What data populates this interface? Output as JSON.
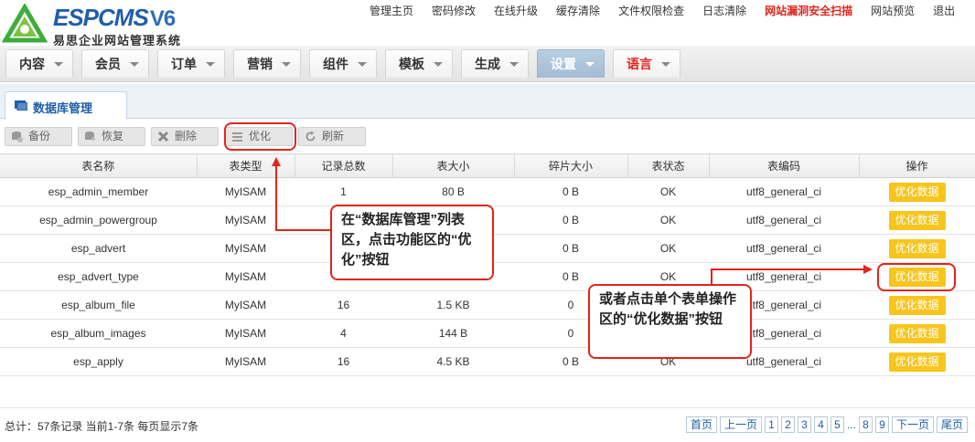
{
  "brand": {
    "logo_text": "ESPCMS",
    "logo_version": "V6",
    "logo_subtitle": "易思企业网站管理系统"
  },
  "top_links": [
    {
      "label": "管理主页",
      "warn": false
    },
    {
      "label": "密码修改",
      "warn": false
    },
    {
      "label": "在线升级",
      "warn": false
    },
    {
      "label": "缓存清除",
      "warn": false
    },
    {
      "label": "文件权限检查",
      "warn": false
    },
    {
      "label": "日志清除",
      "warn": false
    },
    {
      "label": "网站漏洞安全扫描",
      "warn": true
    },
    {
      "label": "网站预览",
      "warn": false
    },
    {
      "label": "退出",
      "warn": false
    }
  ],
  "main_nav": [
    {
      "label": "内容",
      "state": ""
    },
    {
      "label": "会员",
      "state": ""
    },
    {
      "label": "订单",
      "state": ""
    },
    {
      "label": "营销",
      "state": ""
    },
    {
      "label": "组件",
      "state": ""
    },
    {
      "label": "模板",
      "state": ""
    },
    {
      "label": "生成",
      "state": ""
    },
    {
      "label": "设置",
      "state": "active"
    },
    {
      "label": "语言",
      "state": "red"
    }
  ],
  "panel": {
    "tab_label": "数据库管理"
  },
  "toolbar": {
    "buttons": [
      {
        "label": "备份",
        "icon": "backup-icon"
      },
      {
        "label": "恢复",
        "icon": "restore-icon"
      },
      {
        "label": "删除",
        "icon": "delete-icon"
      },
      {
        "label": "优化",
        "icon": "optimize-icon"
      },
      {
        "label": "刷新",
        "icon": "refresh-icon"
      }
    ]
  },
  "table": {
    "headers": [
      "表名称",
      "表类型",
      "记录总数",
      "表大小",
      "碎片大小",
      "表状态",
      "表编码",
      "操作"
    ],
    "rows": [
      [
        "esp_admin_member",
        "MyISAM",
        "1",
        "80 B",
        "0 B",
        "OK",
        "utf8_general_ci"
      ],
      [
        "esp_admin_powergroup",
        "MyISAM",
        "",
        "",
        "0 B",
        "OK",
        "utf8_general_ci"
      ],
      [
        "esp_advert",
        "MyISAM",
        "",
        "",
        "0 B",
        "OK",
        "utf8_general_ci"
      ],
      [
        "esp_advert_type",
        "MyISAM",
        "",
        "",
        "0 B",
        "OK",
        "utf8_general_ci"
      ],
      [
        "esp_album_file",
        "MyISAM",
        "16",
        "1.5 KB",
        "0",
        "",
        "utf8_general_ci"
      ],
      [
        "esp_album_images",
        "MyISAM",
        "4",
        "144 B",
        "0",
        "",
        "utf8_general_ci"
      ],
      [
        "esp_apply",
        "MyISAM",
        "16",
        "4.5 KB",
        "0 B",
        "OK",
        "utf8_general_ci"
      ]
    ],
    "action_label": "优化数据"
  },
  "footer": {
    "summary": "总计：57条记录 当前1-7条 每页显示7条"
  },
  "pager": {
    "first": "首页",
    "prev": "上一页",
    "pages": [
      "1",
      "2",
      "3",
      "4",
      "5"
    ],
    "dots": "...",
    "tail_pages": [
      "8",
      "9"
    ],
    "next": "下一页",
    "last": "尾页"
  },
  "callouts": {
    "toolbar_hint": "在“数据库管理”列表区，点击功能区的“优化”按钮",
    "row_hint": "或者点击单个表单操作区的“优化数据”按钮"
  },
  "colors": {
    "accent": "#1f5ea8",
    "warn": "#e2241b",
    "action_button": "#f7c51b",
    "annotation": "#e2241b"
  }
}
